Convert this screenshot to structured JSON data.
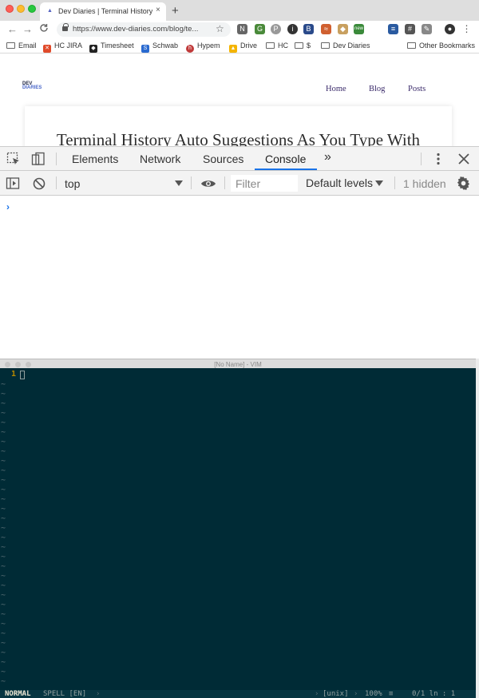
{
  "browser": {
    "tab": {
      "title": "Dev Diaries | Terminal History Au",
      "close": "×"
    },
    "new_tab": "+",
    "toolbar": {
      "back": "←",
      "forward": "→",
      "reload": "C",
      "url": "https://www.dev-diaries.com/blog/te...",
      "star": "☆"
    },
    "extensions": [
      "N",
      "G",
      "P",
      "i",
      "B",
      "≈",
      "◆",
      "new",
      "≡",
      "#",
      "✎",
      "●",
      "⋮"
    ],
    "bookmarks": [
      {
        "label": "Email",
        "icon": "folder-icon"
      },
      {
        "label": "HC JIRA",
        "icon": "jira-icon"
      },
      {
        "label": "Timesheet",
        "icon": "timesheet-icon"
      },
      {
        "label": "Schwab",
        "icon": "schwab-icon"
      },
      {
        "label": "Hypem",
        "icon": "hypem-icon"
      },
      {
        "label": "Drive",
        "icon": "drive-icon"
      },
      {
        "label": "HC",
        "icon": "folder-icon"
      },
      {
        "label": "$",
        "icon": "folder-icon"
      },
      {
        "label": "Dev Diaries",
        "icon": "folder-icon"
      },
      {
        "label": "Other Bookmarks",
        "icon": "folder-icon"
      }
    ]
  },
  "page": {
    "logo_line1": "DEV",
    "logo_line2": "DIARIES",
    "nav": [
      "Home",
      "Blog",
      "Posts"
    ],
    "post_title": "Terminal History Auto Suggestions As You Type With"
  },
  "devtools": {
    "tabs": [
      "Elements",
      "Network",
      "Sources",
      "Console"
    ],
    "active_tab": "Console",
    "more": "»",
    "context": "top",
    "filter_placeholder": "Filter",
    "levels": "Default levels",
    "hidden": "1 hidden",
    "prompt": "›"
  },
  "vim": {
    "title": "[No Name] - VIM",
    "line_number": "1",
    "tilde": "~",
    "status": {
      "mode": "NORMAL",
      "spell": "SPELL [EN]",
      "sep": "›",
      "format": "[unix]",
      "percent": "100%",
      "lines_icon": "≡",
      "position": "0/1 ln :  1"
    }
  },
  "colors": {
    "vim_bg": "#002b36",
    "devtools_accent": "#1a73e8",
    "line_nr": "#b58900"
  }
}
